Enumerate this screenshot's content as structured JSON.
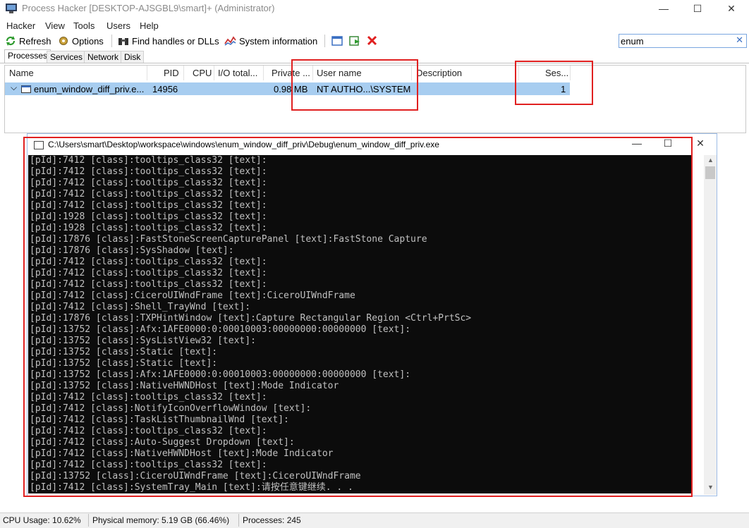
{
  "window": {
    "title": "Process Hacker [DESKTOP-AJSGBL9\\smart]+ (Administrator)",
    "minimize": "—",
    "maximize": "☐",
    "close": "✕"
  },
  "menu": [
    "Hacker",
    "View",
    "Tools",
    "Users",
    "Help"
  ],
  "toolbar": {
    "refresh": "Refresh",
    "options": "Options",
    "find_handles": "Find handles or DLLs",
    "system_info": "System information"
  },
  "search": {
    "value": "enum",
    "clear": "✕"
  },
  "tabs": [
    "Processes",
    "Services",
    "Network",
    "Disk"
  ],
  "columns": {
    "name": "Name",
    "pid": "PID",
    "cpu": "CPU",
    "io": "I/O total...",
    "private": "Private ...",
    "user": "User name",
    "description": "Description",
    "session": "Ses..."
  },
  "process_row": {
    "name": "enum_window_diff_priv.e...",
    "pid": "14956",
    "private": "0.98 MB",
    "user": "NT AUTHO...\\SYSTEM",
    "session": "1"
  },
  "console": {
    "title": "C:\\Users\\smart\\Desktop\\workspace\\windows\\enum_window_diff_priv\\Debug\\enum_window_diff_priv.exe",
    "minimize": "—",
    "maximize": "☐",
    "close": "✕",
    "lines": [
      "[pId]:7412 [class]:tooltips_class32 [text]:",
      "[pId]:7412 [class]:tooltips_class32 [text]:",
      "[pId]:7412 [class]:tooltips_class32 [text]:",
      "[pId]:7412 [class]:tooltips_class32 [text]:",
      "[pId]:7412 [class]:tooltips_class32 [text]:",
      "[pId]:1928 [class]:tooltips_class32 [text]:",
      "[pId]:1928 [class]:tooltips_class32 [text]:",
      "[pId]:17876 [class]:FastStoneScreenCapturePanel [text]:FastStone Capture",
      "[pId]:17876 [class]:SysShadow [text]:",
      "[pId]:7412 [class]:tooltips_class32 [text]:",
      "[pId]:7412 [class]:tooltips_class32 [text]:",
      "[pId]:7412 [class]:tooltips_class32 [text]:",
      "[pId]:7412 [class]:CiceroUIWndFrame [text]:CiceroUIWndFrame",
      "[pId]:7412 [class]:Shell_TrayWnd [text]:",
      "[pId]:17876 [class]:TXPHintWindow [text]:Capture Rectangular Region <Ctrl+PrtSc>",
      "[pId]:13752 [class]:Afx:1AFE0000:0:00010003:00000000:00000000 [text]:",
      "[pId]:13752 [class]:SysListView32 [text]:",
      "[pId]:13752 [class]:Static [text]:",
      "[pId]:13752 [class]:Static [text]:",
      "[pId]:13752 [class]:Afx:1AFE0000:0:00010003:00000000:00000000 [text]:",
      "[pId]:13752 [class]:NativeHWNDHost [text]:Mode Indicator",
      "[pId]:7412 [class]:tooltips_class32 [text]:",
      "[pId]:7412 [class]:NotifyIconOverflowWindow [text]:",
      "[pId]:7412 [class]:TaskListThumbnailWnd [text]:",
      "[pId]:7412 [class]:tooltips_class32 [text]:",
      "[pId]:7412 [class]:Auto-Suggest Dropdown [text]:",
      "[pId]:7412 [class]:NativeHWNDHost [text]:Mode Indicator",
      "[pId]:7412 [class]:tooltips_class32 [text]:",
      "[pId]:13752 [class]:CiceroUIWndFrame [text]:CiceroUIWndFrame",
      "[pId]:7412 [class]:SystemTray_Main [text]:请按任意键继续. . ."
    ]
  },
  "status": {
    "cpu": "CPU Usage: 10.62%",
    "memory": "Physical memory: 5.19 GB (66.46%)",
    "processes": "Processes: 245"
  },
  "colors": {
    "highlight": "#e02020",
    "selection": "#a7cdf0",
    "console_bg": "#0c0c0c"
  }
}
